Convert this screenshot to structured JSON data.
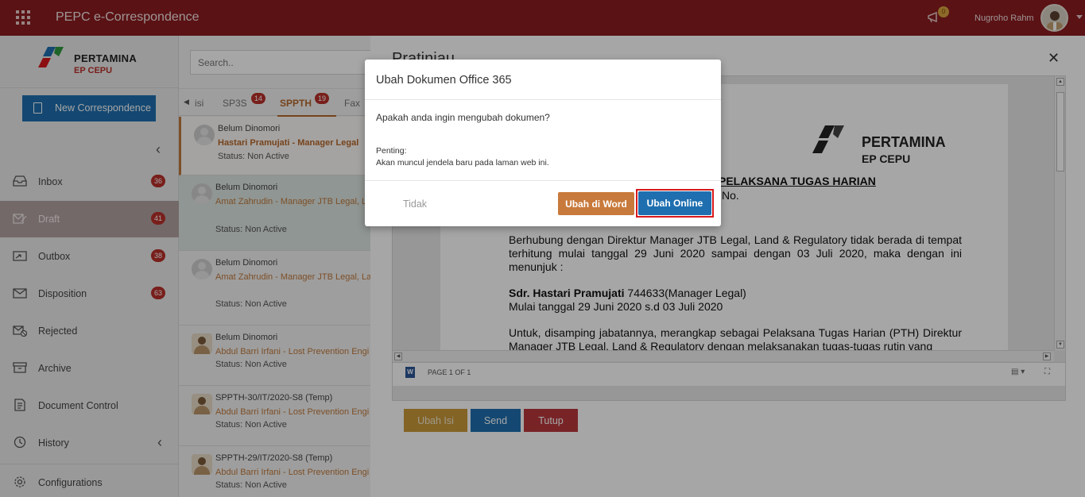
{
  "topbar": {
    "app_title": "PEPC e-Correspondence",
    "notification_count": "0",
    "user_name": "Nugroho Rahm"
  },
  "logo": {
    "line1": "PERTAMINA",
    "line2": "EP CEPU"
  },
  "sidebar": {
    "new_button": "New Correspondence",
    "items": [
      {
        "label": "Inbox",
        "badge": "36",
        "icon": "inbox-icon"
      },
      {
        "label": "Draft",
        "badge": "41",
        "icon": "draft-icon"
      },
      {
        "label": "Outbox",
        "badge": "38",
        "icon": "outbox-icon"
      },
      {
        "label": "Disposition",
        "badge": "63",
        "icon": "disposition-icon"
      },
      {
        "label": "Rejected",
        "icon": "rejected-icon"
      },
      {
        "label": "Archive",
        "icon": "archive-icon"
      },
      {
        "label": "Document Control",
        "icon": "document-control-icon"
      },
      {
        "label": "History",
        "icon": "history-icon"
      },
      {
        "label": "Configurations",
        "icon": "gear-icon"
      }
    ]
  },
  "list": {
    "search_placeholder": "Search..",
    "tabs": [
      {
        "label": "isi"
      },
      {
        "label": "SP3S",
        "badge": "14"
      },
      {
        "label": "SPPTH",
        "badge": "19"
      },
      {
        "label": "Fax"
      }
    ],
    "items": [
      {
        "number": "Belum Dinomori",
        "from": "Hastari Pramujati - Manager Legal",
        "status": "Status: Non Active"
      },
      {
        "number": "Belum Dinomori",
        "from": "Amat Zahrudin - Manager JTB Legal, L",
        "status": "Status: Non Active"
      },
      {
        "number": "Belum Dinomori",
        "from": "Amat Zahrudin - Manager JTB Legal, Lan",
        "status": "Status: Non Active"
      },
      {
        "number": "Belum Dinomori",
        "from": "Abdul Barri Irfani - Lost Prevention Engi",
        "status": "Status: Non Active"
      },
      {
        "number": "SPPTH-30/IT/2020-S8 (Temp)",
        "from": "Abdul Barri Irfani - Lost Prevention Engi",
        "status": "Status: Non Active"
      },
      {
        "number": "SPPTH-29/IT/2020-S8 (Temp)",
        "from": "Abdul Barri Irfani - Lost Prevention Engi",
        "status": "Status: Non Active"
      }
    ]
  },
  "preview": {
    "title": "Pratinjau",
    "doc": {
      "logo_line1": "PERTAMINA",
      "logo_line2": "EP CEPU",
      "heading": "PELAKSANA TUGAS HARIAN",
      "number": "No.",
      "para1": "Berhubung dengan Direktur Manager JTB Legal, Land & Regulatory tidak berada di tempat terhitung mulai tanggal 29 Juni 2020 sampai dengan 03 Juli 2020, maka dengan ini menunjuk :",
      "appointee_name": "Sdr. Hastari Pramujati",
      "appointee_role": " 744633(Manager Legal)",
      "period": "Mulai tanggal 29 Juni 2020 s.d 03 Juli 2020",
      "para2": "Untuk, disamping jabatannya, merangkap sebagai Pelaksana Tugas Harian (PTH) Direktur Manager JTB Legal, Land & Regulatory dengan melaksanakan tugas-tugas rutin yang"
    },
    "page_info": "PAGE 1 OF 1",
    "buttons": {
      "edit": "Ubah Isi",
      "send": "Send",
      "close": "Tutup"
    }
  },
  "modal": {
    "title": "Ubah Dokumen Office 365",
    "question": "Apakah anda ingin mengubah dokumen?",
    "note_label": "Penting:",
    "note_text": "Akan muncul jendela baru pada laman web ini.",
    "btn_no": "Tidak",
    "btn_word": "Ubah di Word",
    "btn_online": "Ubah Online"
  },
  "colors": {
    "topbar": "#8b1c1f",
    "primary": "#1f6fb0",
    "accent": "#c87a3c",
    "badge": "#b8312a",
    "highlight_outline": "#d7191c"
  }
}
